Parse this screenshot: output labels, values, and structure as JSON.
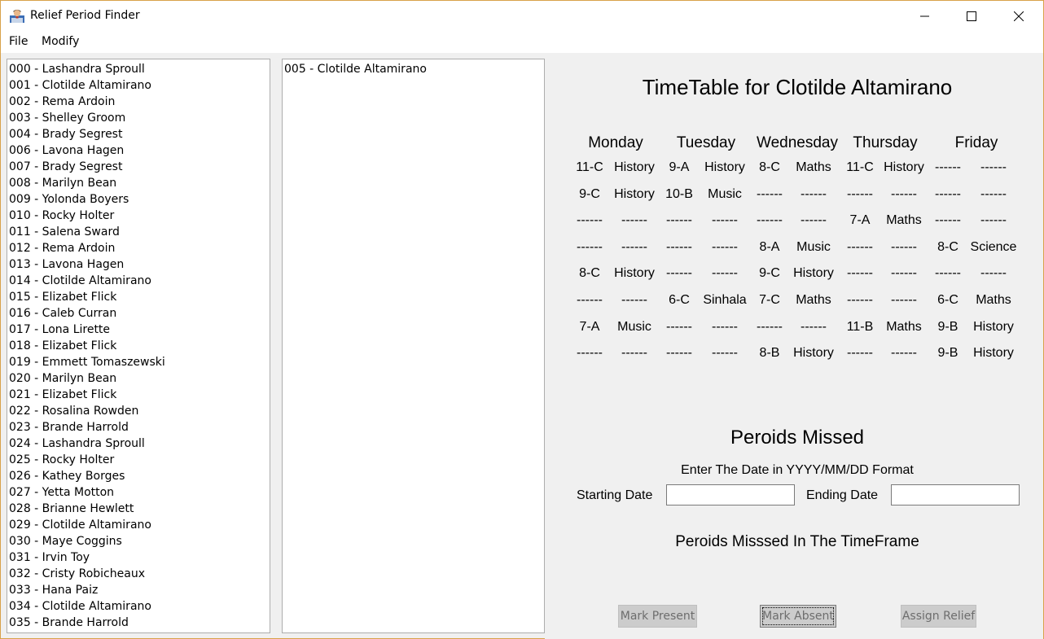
{
  "window": {
    "title": "Relief Period Finder"
  },
  "menu": {
    "file": "File",
    "modify": "Modify"
  },
  "teachers": [
    "000 - Lashandra Sproull",
    "001 - Clotilde Altamirano",
    "002 - Rema Ardoin",
    "003 - Shelley Groom",
    "004 - Brady Segrest",
    "006 - Lavona Hagen",
    "007 - Brady Segrest",
    "008 - Marilyn Bean",
    "009 - Yolonda Boyers",
    "010 - Rocky Holter",
    "011 - Salena Sward",
    "012 - Rema Ardoin",
    "013 - Lavona Hagen",
    "014 - Clotilde Altamirano",
    "015 - Elizabet Flick",
    "016 - Caleb Curran",
    "017 - Lona Lirette",
    "018 - Elizabet Flick",
    "019 - Emmett Tomaszewski",
    "020 - Marilyn Bean",
    "021 - Elizabet Flick",
    "022 - Rosalina Rowden",
    "023 - Brande Harrold",
    "024 - Lashandra Sproull",
    "025 - Rocky Holter",
    "026 - Kathey Borges",
    "027 - Yetta Motton",
    "028 - Brianne Hewlett",
    "029 - Clotilde Altamirano",
    "030 - Maye Coggins",
    "031 - Irvin Toy",
    "032 - Cristy Robicheaux",
    "033 - Hana Paiz",
    "034 - Clotilde Altamirano",
    "035 - Brande Harrold"
  ],
  "selected_list": [
    "005 - Clotilde Altamirano"
  ],
  "timetable": {
    "title": "TimeTable for Clotilde Altamirano",
    "days": [
      "Monday",
      "Tuesday",
      "Wednesday",
      "Thursday",
      "Friday"
    ],
    "rows": [
      [
        [
          "11-C",
          "History"
        ],
        [
          "9-A",
          "History"
        ],
        [
          "8-C",
          "Maths"
        ],
        [
          "11-C",
          "History"
        ],
        [
          "------",
          "------"
        ]
      ],
      [
        [
          "9-C",
          "History"
        ],
        [
          "10-B",
          "Music"
        ],
        [
          "------",
          "------"
        ],
        [
          "------",
          "------"
        ],
        [
          "------",
          "------"
        ]
      ],
      [
        [
          "------",
          "------"
        ],
        [
          "------",
          "------"
        ],
        [
          "------",
          "------"
        ],
        [
          "7-A",
          "Maths"
        ],
        [
          "------",
          "------"
        ]
      ],
      [
        [
          "------",
          "------"
        ],
        [
          "------",
          "------"
        ],
        [
          "8-A",
          "Music"
        ],
        [
          "------",
          "------"
        ],
        [
          "8-C",
          "Science"
        ]
      ],
      [
        [
          "8-C",
          "History"
        ],
        [
          "------",
          "------"
        ],
        [
          "9-C",
          "History"
        ],
        [
          "------",
          "------"
        ],
        [
          "------",
          "------"
        ]
      ],
      [
        [
          "------",
          "------"
        ],
        [
          "6-C",
          "Sinhala"
        ],
        [
          "7-C",
          "Maths"
        ],
        [
          "------",
          "------"
        ],
        [
          "6-C",
          "Maths"
        ]
      ],
      [
        [
          "7-A",
          "Music"
        ],
        [
          "------",
          "------"
        ],
        [
          "------",
          "------"
        ],
        [
          "11-B",
          "Maths"
        ],
        [
          "9-B",
          "History"
        ]
      ],
      [
        [
          "------",
          "------"
        ],
        [
          "------",
          "------"
        ],
        [
          "8-B",
          "History"
        ],
        [
          "------",
          "------"
        ],
        [
          "9-B",
          "History"
        ]
      ]
    ]
  },
  "missed": {
    "title": "Peroids Missed",
    "hint": "Enter The Date in YYYY/MM/DD Format",
    "start_label": "Starting Date",
    "start_value": "",
    "end_label": "Ending Date",
    "end_value": "",
    "result_label": "Peroids Misssed In The TimeFrame"
  },
  "buttons": {
    "present": "Mark Present",
    "absent": "Mark Absent",
    "relief": "Assign Relief"
  }
}
